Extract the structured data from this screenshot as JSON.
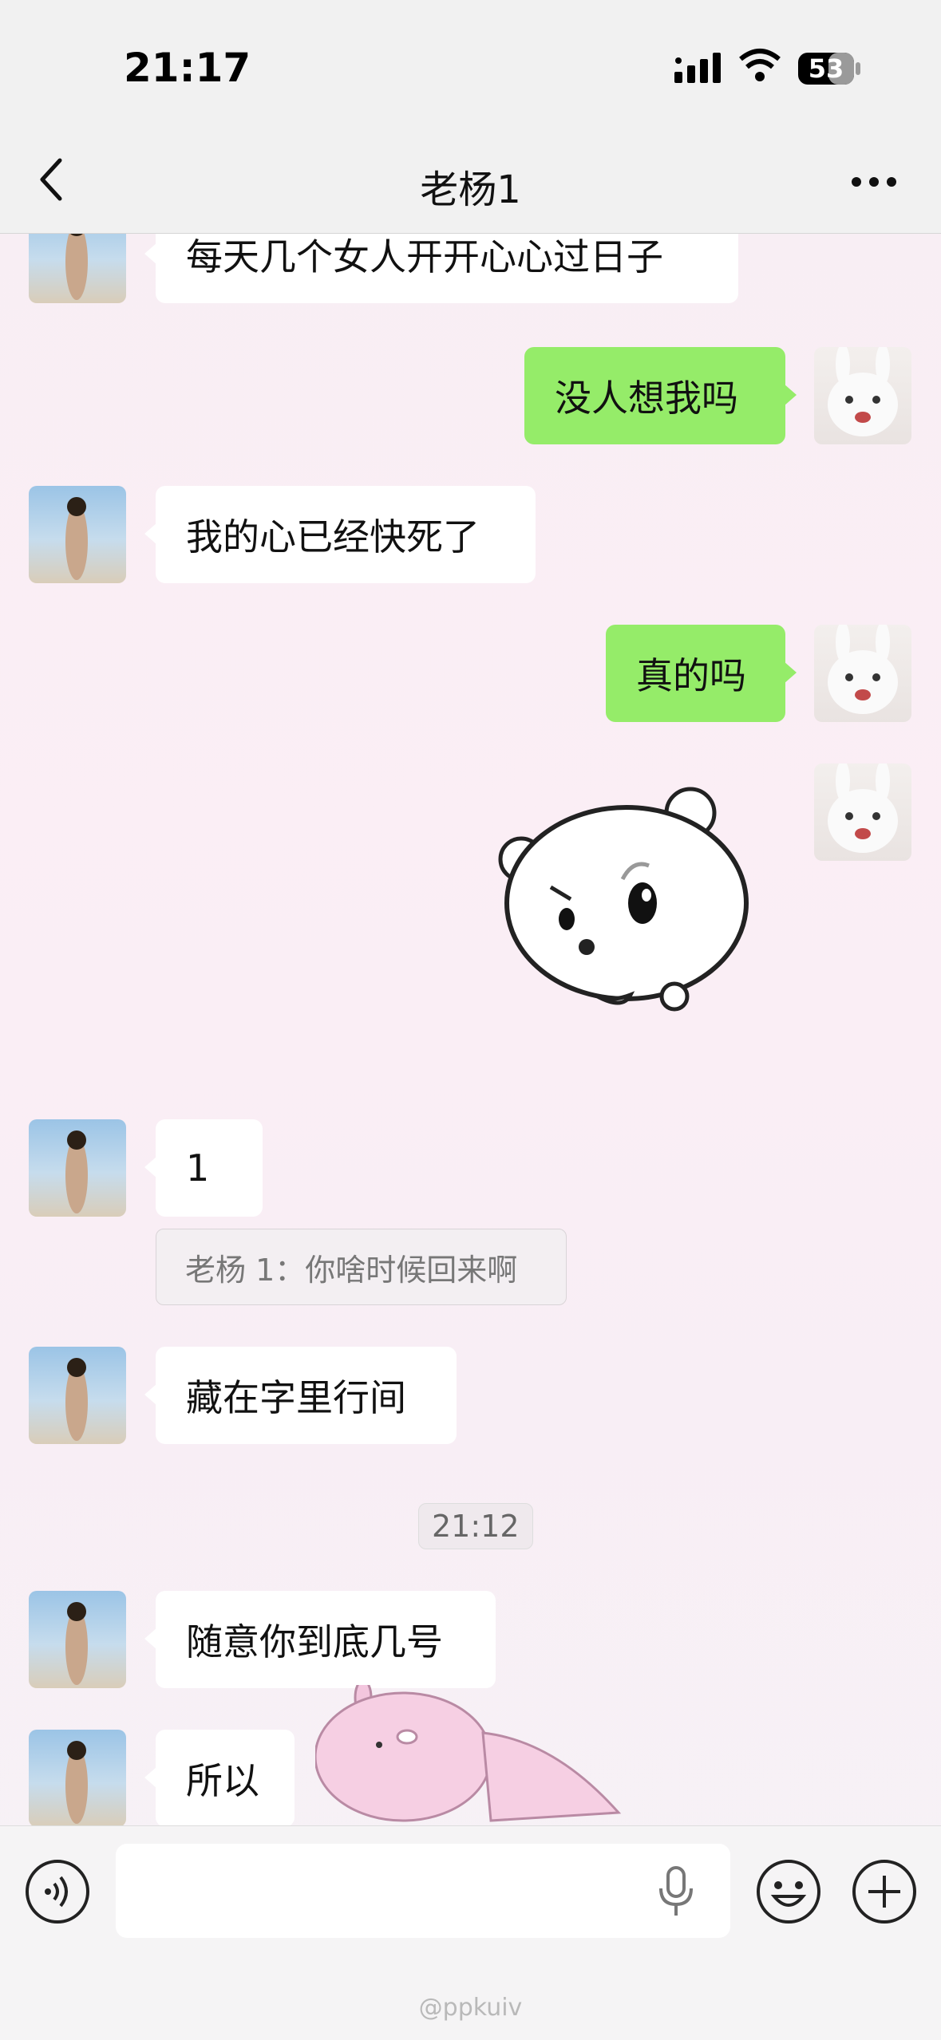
{
  "status_bar": {
    "time": "21:17",
    "battery": "53"
  },
  "header": {
    "title": "老杨1"
  },
  "messages": [
    {
      "side": "in",
      "text": "每天几个女人开开心心过日子"
    },
    {
      "side": "out",
      "text": "没人想我吗"
    },
    {
      "side": "in",
      "text": "我的心已经快死了"
    },
    {
      "side": "out",
      "text": "真的吗"
    },
    {
      "side": "out",
      "type": "sticker",
      "sticker": "white-round-bunny-angry"
    },
    {
      "side": "in",
      "text": "1"
    },
    {
      "side": "in",
      "text": "藏在字里行间"
    },
    {
      "side": "in",
      "text": "随意你到底几号"
    },
    {
      "side": "in",
      "text": "所以"
    }
  ],
  "quote": {
    "text": "老杨 1：你啥时候回来啊"
  },
  "timestamp": {
    "text": "21:12"
  },
  "watermark": {
    "text": "@ppkuiv"
  },
  "colors": {
    "outgoing_bubble": "#95ec69",
    "incoming_bubble": "#ffffff"
  }
}
